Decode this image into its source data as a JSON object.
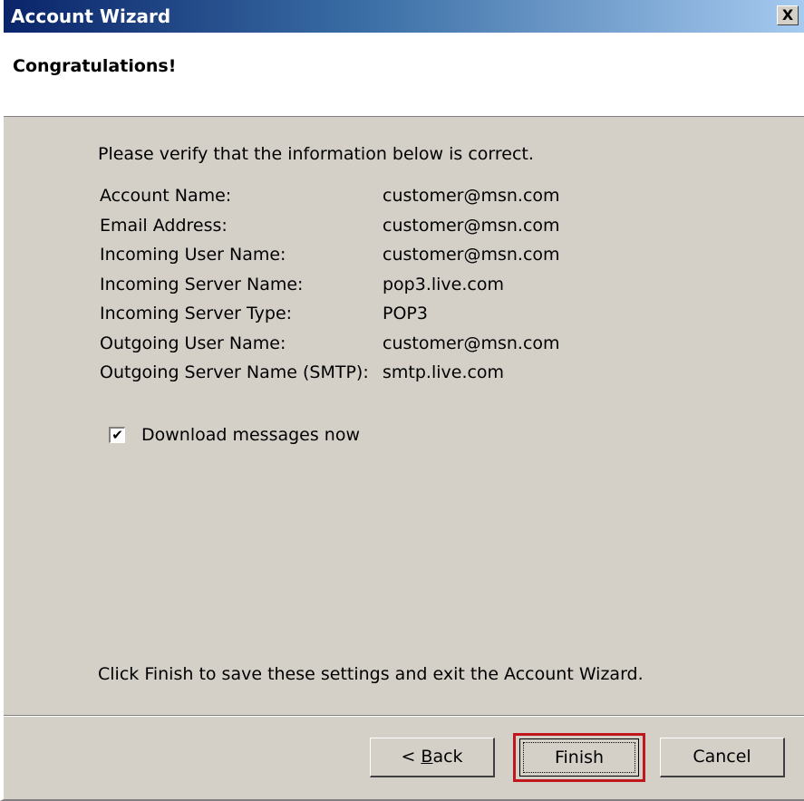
{
  "window": {
    "title": "Account Wizard",
    "close_label": "X"
  },
  "header": {
    "title": "Congratulations!"
  },
  "content": {
    "intro": "Please verify that the information below is correct.",
    "summary": [
      {
        "label": "Account Name:",
        "value": "customer@msn.com"
      },
      {
        "label": "Email Address:",
        "value": "customer@msn.com"
      },
      {
        "label": "Incoming User Name:",
        "value": "customer@msn.com"
      },
      {
        "label": "Incoming Server Name:",
        "value": "pop3.live.com"
      },
      {
        "label": "Incoming Server Type:",
        "value": "POP3"
      },
      {
        "label": "Outgoing User Name:",
        "value": "customer@msn.com"
      },
      {
        "label": "Outgoing Server Name (SMTP):",
        "value": "smtp.live.com"
      }
    ],
    "download_checkbox": {
      "label": "Download messages now",
      "checked": true,
      "check_glyph": "✔"
    },
    "finish_note": "Click Finish to save these settings and exit the Account Wizard."
  },
  "buttons": {
    "back_prefix": "< ",
    "back_accel": "B",
    "back_rest": "ack",
    "finish": "Finish",
    "cancel": "Cancel"
  },
  "colors": {
    "title_gradient_start": "#0a246a",
    "title_gradient_end": "#a6caf0",
    "dialog_bg": "#d4d0c8",
    "highlight_border": "#c0171f"
  }
}
